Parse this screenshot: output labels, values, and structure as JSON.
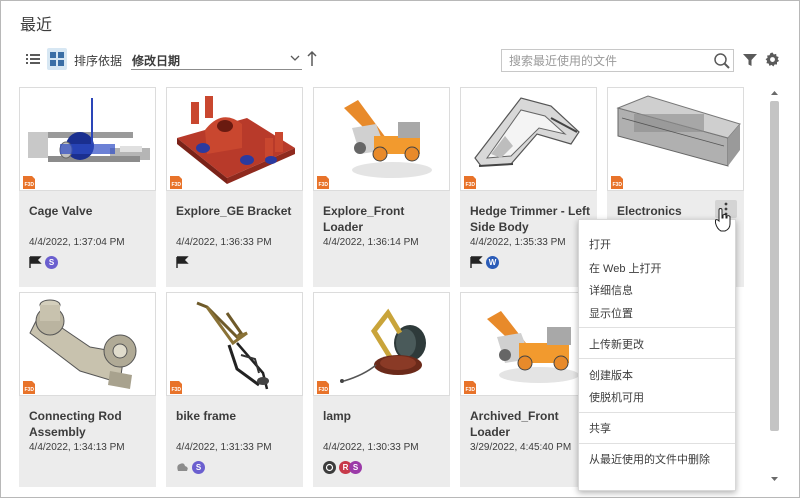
{
  "page": {
    "title": "最近"
  },
  "toolbar": {
    "sort_label": "排序依据",
    "sort_value": "修改日期",
    "search_placeholder": "搜索最近使用的文件"
  },
  "files": [
    {
      "name": "Cage Valve",
      "date": "4/4/2022, 1:37:04 PM"
    },
    {
      "name": "Explore_GE Bracket",
      "date": "4/4/2022, 1:36:33 PM"
    },
    {
      "name": "Explore_Front Loader",
      "date": "4/4/2022, 1:36:14 PM"
    },
    {
      "name": "Hedge Trimmer - Left Side Body",
      "date": "4/4/2022, 1:35:33 PM"
    },
    {
      "name": "Electronics",
      "date": ""
    },
    {
      "name": "Connecting Rod Assembly",
      "date": "4/4/2022, 1:34:13 PM"
    },
    {
      "name": "bike frame",
      "date": "4/4/2022, 1:31:33 PM"
    },
    {
      "name": "lamp",
      "date": "4/4/2022, 1:30:33 PM"
    },
    {
      "name": "Archived_Front Loader",
      "date": "3/29/2022, 4:45:40 PM"
    }
  ],
  "badges": {
    "w": "W",
    "r": "R",
    "s": "S"
  },
  "menu": {
    "open": "打开",
    "open_web": "在 Web 上打开",
    "details": "详细信息",
    "show_location": "显示位置",
    "upload_changes": "上传新更改",
    "create_version": "创建版本",
    "offline": "使脱机可用",
    "share": "共享",
    "remove_recent": "从最近使用的文件中删除"
  },
  "colors": {
    "accent": "#0696d7",
    "card_bg": "#ececec",
    "view_active": "#d7e7f3",
    "f3d_orange": "#e8732a"
  }
}
